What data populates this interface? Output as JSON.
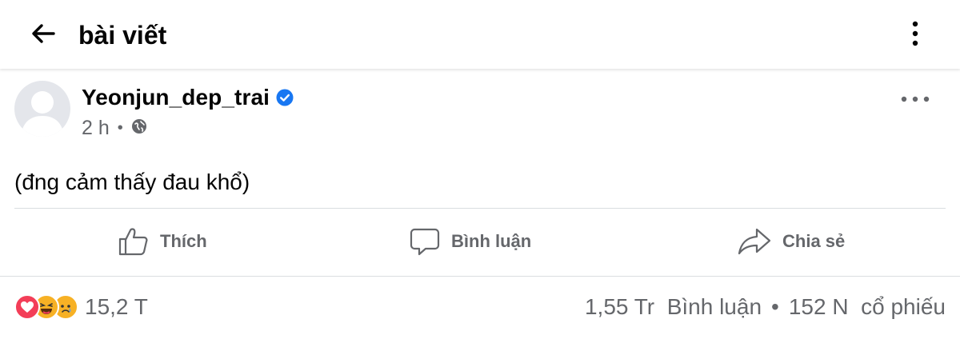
{
  "header": {
    "title": "bài viết",
    "back_icon": "arrow-left-icon",
    "menu_icon": "kebab-menu-icon"
  },
  "post": {
    "author": "Yeonjun_dep_trai",
    "verified_icon": "verified-badge-icon",
    "time": "2 h",
    "privacy_icon": "globe-icon",
    "text": "(đng cảm thấy đau khổ)",
    "more_icon": "more-horizontal-icon"
  },
  "actions": {
    "like_label": "Thích",
    "comment_label": "Bình luận",
    "share_label": "Chia sẻ"
  },
  "footer": {
    "reaction_icons": [
      "love-reaction-icon",
      "haha-reaction-icon",
      "sad-reaction-icon"
    ],
    "reaction_count": "15,2 T",
    "comments_count": "1,55 Tr",
    "comments_label": "Bình luận",
    "separator": "•",
    "shares_count": "152 N",
    "shares_label": "cổ phiếu"
  },
  "colors": {
    "text_primary": "#050505",
    "text_secondary": "#65676b",
    "verified_blue": "#1877f2",
    "love_red": "#f33e58",
    "emoji_yellow": "#f7b125",
    "divider": "#dadde1"
  }
}
